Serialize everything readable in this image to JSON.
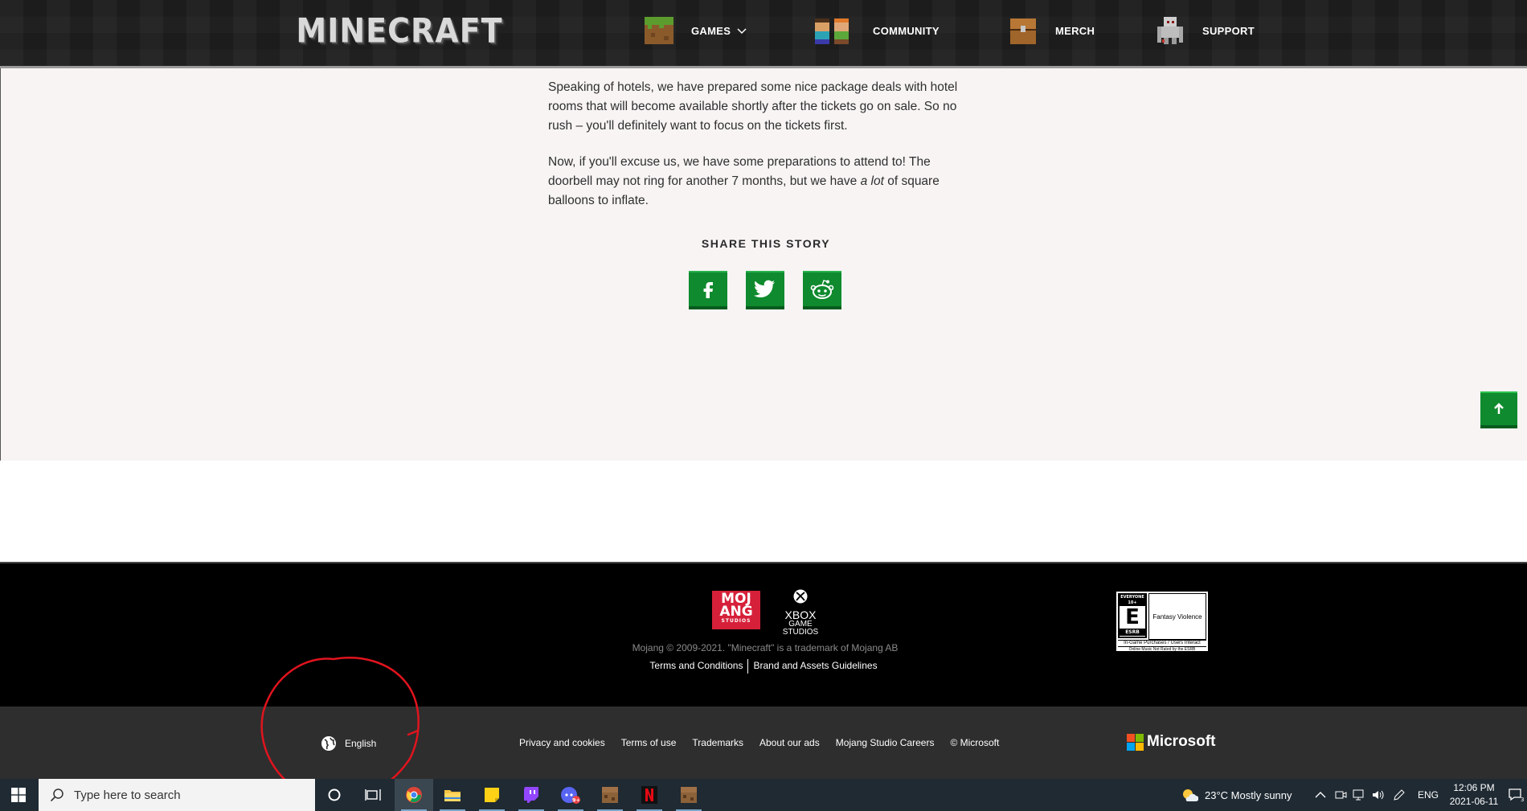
{
  "header": {
    "logo_text": "MINECRAFT",
    "nav": [
      {
        "label": "GAMES",
        "icon": "grass-block-icon"
      },
      {
        "label": "COMMUNITY",
        "icon": "characters-icon"
      },
      {
        "label": "MERCH",
        "icon": "chest-icon"
      },
      {
        "label": "SUPPORT",
        "icon": "iron-golem-icon"
      }
    ]
  },
  "article": {
    "p1": "Speaking of hotels, we have prepared some nice package deals with hotel rooms that will become available shortly after the tickets go on sale. So no rush – you'll definitely want to focus on the tickets first.",
    "p2_before": "Now, if you'll excuse us, we have some preparations to attend to! The doorbell may not ring for another 7 months, but we have ",
    "p2_em": "a lot",
    "p2_after": " of square balloons to inflate.",
    "share_title": "SHARE THIS STORY",
    "share_buttons": [
      "facebook-icon",
      "twitter-icon",
      "reddit-icon"
    ]
  },
  "footer": {
    "mojang_logo": {
      "line1": "MOJ",
      "line2": "ANG",
      "line3": "STUDIOS"
    },
    "xbox_logo": {
      "line1": "XBOX",
      "line2": "GAME STUDIOS"
    },
    "copyright": "Mojang © 2009-2021. \"Minecraft\" is a trademark of Mojang AB",
    "terms": "Terms and Conditions",
    "brand": "Brand and Assets Guidelines",
    "esrb": {
      "top": "EVERYONE 10+",
      "rating": "E",
      "org": "ESRB",
      "descriptor": "Fantasy Violence",
      "line1": "In-Game Purchases / Users Interact",
      "line2": "Online Music Not Rated by the ESRB"
    },
    "language": "English",
    "links": [
      "Privacy and cookies",
      "Terms of use",
      "Trademarks",
      "About our ads",
      "Mojang Studio Careers",
      "© Microsoft"
    ],
    "microsoft": "Microsoft"
  },
  "taskbar": {
    "search_placeholder": "Type here to search",
    "weather": "23°C  Mostly sunny",
    "language": "ENG",
    "time": "12:06 PM",
    "date": "2021-06-11",
    "notification_count": "3",
    "discord_badge": "9+"
  },
  "colors": {
    "share_green": "#0f8a2e",
    "annotation_red": "#e0141e",
    "footer_black": "#000000",
    "taskbar": "#1f2a33"
  }
}
